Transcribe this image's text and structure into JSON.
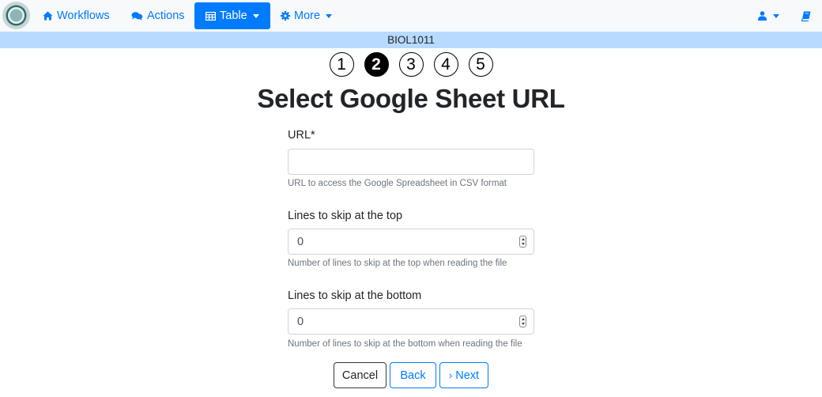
{
  "navbar": {
    "workflows_label": "Workflows",
    "actions_label": "Actions",
    "table_label": "Table",
    "more_label": "More"
  },
  "course_name": "BIOL1011",
  "steps": [
    "①",
    "❷",
    "③",
    "④",
    "⑤"
  ],
  "current_step": 2,
  "page_title": "Select Google Sheet URL",
  "form": {
    "url": {
      "label": "URL*",
      "value": "",
      "help": "URL to access the Google Spreadsheet in CSV format"
    },
    "skip_top": {
      "label": "Lines to skip at the top",
      "value": "0",
      "help": "Number of lines to skip at the top when reading the file"
    },
    "skip_bottom": {
      "label": "Lines to skip at the bottom",
      "value": "0",
      "help": "Number of lines to skip at the bottom when reading the file"
    }
  },
  "buttons": {
    "cancel": "Cancel",
    "back": "Back",
    "next_chevron": "›",
    "next": "Next"
  },
  "colors": {
    "primary": "#007bff",
    "course_bar": "#b8daff",
    "navbar_bg": "#f8f9fa"
  }
}
